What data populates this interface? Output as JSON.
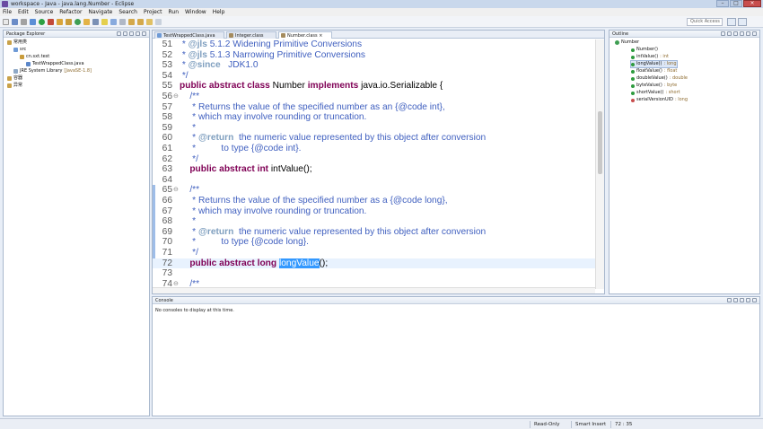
{
  "window": {
    "title": "workspace - Java - java.lang.Number - Eclipse"
  },
  "menu": [
    "File",
    "Edit",
    "Source",
    "Refactor",
    "Navigate",
    "Search",
    "Project",
    "Run",
    "Window",
    "Help"
  ],
  "toolbar": {
    "quick_access_placeholder": "Quick Access"
  },
  "package_explorer": {
    "title": "Package Explorer",
    "items": [
      {
        "label": "常用类",
        "indent": 0
      },
      {
        "label": "src",
        "indent": 1
      },
      {
        "label": "cn.sxt.test",
        "indent": 2
      },
      {
        "label": "TestWrappedClass.java",
        "indent": 3
      },
      {
        "label": "JRE System Library",
        "suffix": "[JavaSE-1.8]",
        "indent": 1
      },
      {
        "label": "容器",
        "indent": 0
      },
      {
        "label": "异常",
        "indent": 0
      }
    ]
  },
  "editor": {
    "tabs": [
      {
        "label": "TestWrappedClass.java",
        "active": false
      },
      {
        "label": "Integer.class",
        "active": false
      },
      {
        "label": "Number.class",
        "active": true
      }
    ],
    "lines": [
      {
        "n": "51",
        "fold": "",
        "text": " * @jls 5.1.2 Widening Primitive Conversions"
      },
      {
        "n": "52",
        "fold": "",
        "text": " * @jls 5.1.3 Narrowing Primitive Conversions"
      },
      {
        "n": "53",
        "fold": "",
        "text": " * @since   JDK1.0"
      },
      {
        "n": "54",
        "fold": "",
        "text": " */"
      },
      {
        "n": "55",
        "fold": "",
        "kw": "public abstract class",
        "text": " Number ",
        "kw2": "implements",
        "text2": " java.io.Serializable {"
      },
      {
        "n": "56",
        "fold": "⊖",
        "text": "    /**"
      },
      {
        "n": "57",
        "fold": "",
        "text": "     * Returns the value of the specified number as an {@code int},"
      },
      {
        "n": "58",
        "fold": "",
        "text": "     * which may involve rounding or truncation."
      },
      {
        "n": "59",
        "fold": "",
        "text": "     *"
      },
      {
        "n": "60",
        "fold": "",
        "text": "     * @return  the numeric value represented by this object after conversion"
      },
      {
        "n": "61",
        "fold": "",
        "text": "     *          to type {@code int}."
      },
      {
        "n": "62",
        "fold": "",
        "text": "     */"
      },
      {
        "n": "63",
        "fold": "",
        "kw": "    public abstract int",
        "text": " intValue();"
      },
      {
        "n": "64",
        "fold": "",
        "text": ""
      },
      {
        "n": "65",
        "fold": "⊖",
        "text": "    /**"
      },
      {
        "n": "66",
        "fold": "",
        "text": "     * Returns the value of the specified number as a {@code long},"
      },
      {
        "n": "67",
        "fold": "",
        "text": "     * which may involve rounding or truncation."
      },
      {
        "n": "68",
        "fold": "",
        "text": "     *"
      },
      {
        "n": "69",
        "fold": "",
        "text": "     * @return  the numeric value represented by this object after conversion"
      },
      {
        "n": "70",
        "fold": "",
        "text": "     *          to type {@code long}."
      },
      {
        "n": "71",
        "fold": "",
        "text": "     */"
      },
      {
        "n": "72",
        "fold": "",
        "kw": "    public abstract long",
        "text": " ",
        "sel": "longValue",
        "text2": "();"
      },
      {
        "n": "73",
        "fold": "",
        "text": ""
      },
      {
        "n": "74",
        "fold": "⊖",
        "text": "    /**"
      }
    ]
  },
  "outline": {
    "title": "Outline",
    "root": "Number",
    "items": [
      {
        "label": "Number()",
        "type": ""
      },
      {
        "label": "intValue()",
        "type": " : int"
      },
      {
        "label": "longValue()",
        "type": " : long"
      },
      {
        "label": "floatValue()",
        "type": " : float"
      },
      {
        "label": "doubleValue()",
        "type": " : double"
      },
      {
        "label": "byteValue()",
        "type": " : byte"
      },
      {
        "label": "shortValue()",
        "type": " : short"
      },
      {
        "label": "serialVersionUID",
        "type": " : long"
      }
    ]
  },
  "console": {
    "title": "Console",
    "message": "No consoles to display at this time."
  },
  "status": {
    "mode": "Read-Only",
    "insert": "Smart Insert",
    "position": "72 : 35"
  },
  "colors": {
    "keyword": "#7f0055",
    "comment": "#3f5fbf",
    "selection": "#3399ff",
    "current_line": "#e8f2fe"
  }
}
